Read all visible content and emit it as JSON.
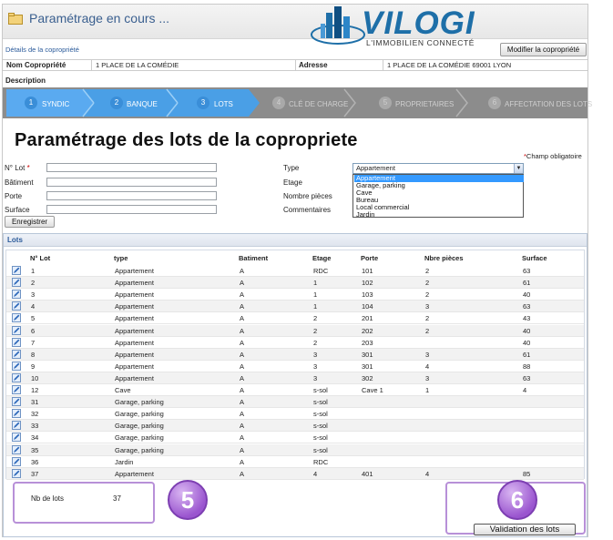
{
  "header": {
    "title": "Paramétrage en cours ..."
  },
  "logo": {
    "name": "VILOGI",
    "tagline": "L'IMMOBILIEN CONNECTÉ",
    "color": "#1e6fa8"
  },
  "details_link": "Détails de la copropriété",
  "modify_button": "Modifier la copropriété",
  "info": {
    "nom_label": "Nom Copropriété",
    "nom_value": "1 PLACE DE LA COMÉDIE",
    "adresse_label": "Adresse",
    "adresse_value": "1 PLACE DE LA COMÉDIE 69001 LYON",
    "description_label": "Description"
  },
  "steps": [
    {
      "num": "1",
      "label": "SYNDIC",
      "active": true
    },
    {
      "num": "2",
      "label": "BANQUE",
      "active": true
    },
    {
      "num": "3",
      "label": "LOTS",
      "active": true
    },
    {
      "num": "4",
      "label": "CLÉ DE CHARGE",
      "active": false
    },
    {
      "num": "5",
      "label": "PROPRIETAIRES",
      "active": false
    },
    {
      "num": "6",
      "label": "AFFECTATION DES LOTS",
      "active": false
    }
  ],
  "page_title": "Paramétrage des lots de la copropriete",
  "required_note": "Champ obligatoire",
  "form": {
    "lot_label": "N° Lot",
    "batiment_label": "Bâtiment",
    "porte_label": "Porte",
    "surface_label": "Surface",
    "type_label": "Type",
    "etage_label": "Etage",
    "pieces_label": "Nombre pièces",
    "commentaires_label": "Commentaires",
    "type_selected": "Appartement",
    "type_options": [
      "Appartement",
      "Garage, parking",
      "Cave",
      "Bureau",
      "Local commercial",
      "Jardin"
    ],
    "save_button": "Enregistrer"
  },
  "lots": {
    "title": "Lots",
    "columns": [
      "N° Lot",
      "type",
      "Batiment",
      "Etage",
      "Porte",
      "Nbre pièces",
      "Surface"
    ],
    "rows": [
      [
        "1",
        "Appartement",
        "A",
        "RDC",
        "101",
        "2",
        "63"
      ],
      [
        "2",
        "Appartement",
        "A",
        "1",
        "102",
        "2",
        "61"
      ],
      [
        "3",
        "Appartement",
        "A",
        "1",
        "103",
        "2",
        "40"
      ],
      [
        "4",
        "Appartement",
        "A",
        "1",
        "104",
        "3",
        "63"
      ],
      [
        "5",
        "Appartement",
        "A",
        "2",
        "201",
        "2",
        "43"
      ],
      [
        "6",
        "Appartement",
        "A",
        "2",
        "202",
        "2",
        "40"
      ],
      [
        "7",
        "Appartement",
        "A",
        "2",
        "203",
        "",
        "40"
      ],
      [
        "8",
        "Appartement",
        "A",
        "3",
        "301",
        "3",
        "61"
      ],
      [
        "9",
        "Appartement",
        "A",
        "3",
        "301",
        "4",
        "88"
      ],
      [
        "10",
        "Appartement",
        "A",
        "3",
        "302",
        "3",
        "63"
      ],
      [
        "12",
        "Cave",
        "A",
        "s-sol",
        "Cave 1",
        "1",
        "4"
      ],
      [
        "31",
        "Garage, parking",
        "A",
        "s-sol",
        "",
        "",
        ""
      ],
      [
        "32",
        "Garage, parking",
        "A",
        "s-sol",
        "",
        "",
        ""
      ],
      [
        "33",
        "Garage, parking",
        "A",
        "s-sol",
        "",
        "",
        ""
      ],
      [
        "34",
        "Garage, parking",
        "A",
        "s-sol",
        "",
        "",
        ""
      ],
      [
        "35",
        "Garage, parking",
        "A",
        "s-sol",
        "",
        "",
        ""
      ],
      [
        "36",
        "Jardin",
        "A",
        "RDC",
        "",
        "",
        ""
      ],
      [
        "37",
        "Appartement",
        "A",
        "4",
        "401",
        "4",
        "85"
      ]
    ],
    "count_label": "Nb de lots",
    "count_value": "37"
  },
  "callouts": {
    "left": "5",
    "right": "6"
  },
  "validate_button": "Validation des lots"
}
